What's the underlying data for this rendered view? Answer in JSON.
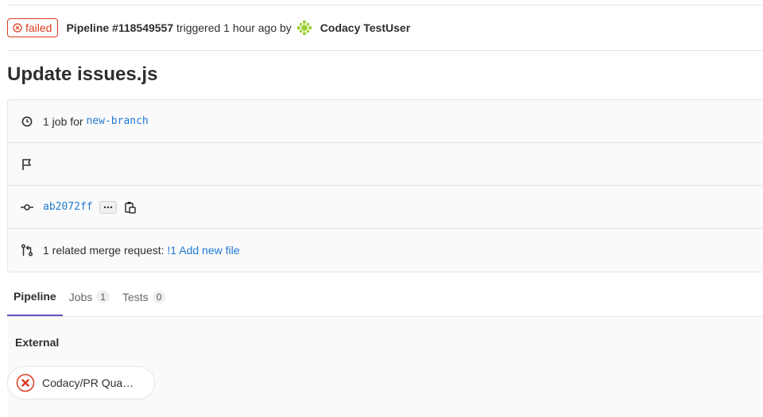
{
  "header": {
    "status": "failed",
    "pipeline_label": "Pipeline #118549557",
    "triggered_text": "triggered 1 hour ago by",
    "user_name": "Codacy TestUser"
  },
  "commit_title": "Update issues.js",
  "info": {
    "jobs_prefix": "1 job for",
    "branch": "new-branch",
    "commit_sha": "ab2072ff",
    "mr_prefix": "1 related merge request:",
    "mr_id": "!1",
    "mr_title": "Add new file"
  },
  "tabs": [
    {
      "label": "Pipeline",
      "count": null
    },
    {
      "label": "Jobs",
      "count": "1"
    },
    {
      "label": "Tests",
      "count": "0"
    }
  ],
  "stage": {
    "title": "External",
    "job_name": "Codacy/PR Qua…",
    "job_status": "failed"
  },
  "colors": {
    "failed": "#db3b21",
    "link": "#1f78d1",
    "active_tab": "#6b4fbb"
  },
  "icons": [
    "failed-status-icon",
    "avatar",
    "clock-icon",
    "flag-icon",
    "commit-icon",
    "ellipsis-icon",
    "clipboard-icon",
    "merge-request-icon",
    "job-failed-icon"
  ]
}
